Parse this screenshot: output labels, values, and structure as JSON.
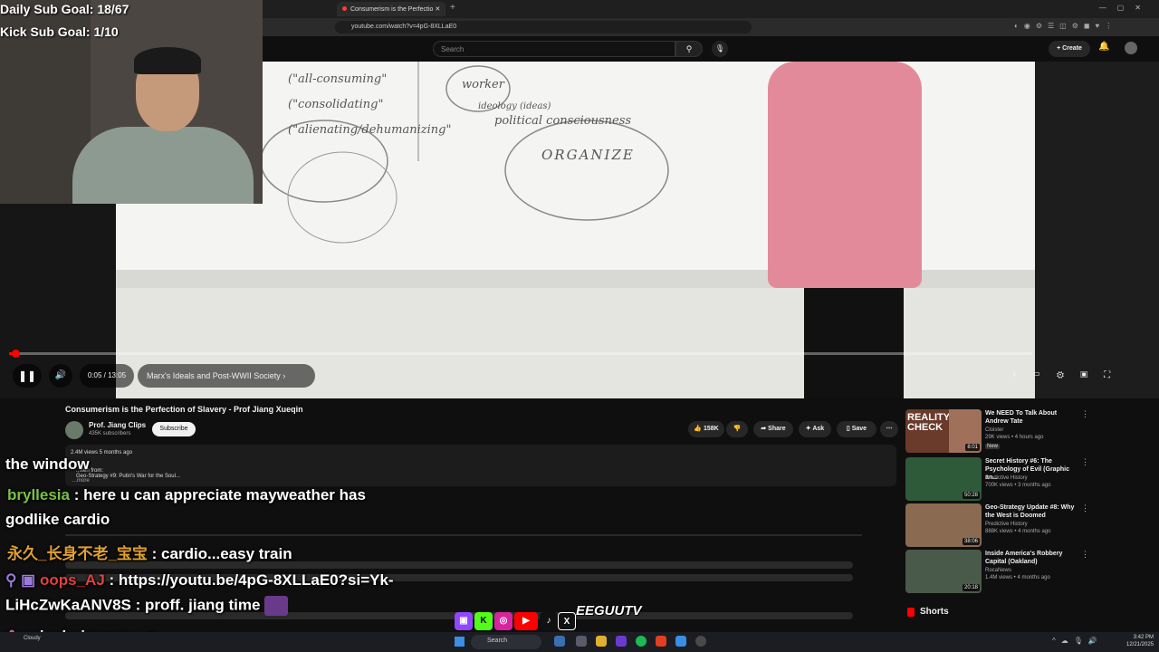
{
  "overlay": {
    "daily_goal": "Daily Sub Goal: 18/67",
    "kick_goal": "Kick Sub Goal: 1/10"
  },
  "browser": {
    "tab_title": "Consumerism is the Perfectio",
    "url": "youtube.com/watch?v=4pG-8XLLaE0"
  },
  "youtube": {
    "search_placeholder": "Search",
    "create_label": "Create",
    "player": {
      "time": "0:05 / 13:05",
      "chapter": "Marx's Ideals and Post-WWII Society",
      "progress": 0.006
    },
    "video": {
      "title": "Consumerism is the Perfection of Slavery - Prof Jiang Xueqin",
      "channel": "Prof. Jiang Clips",
      "subscribers": "435K subscribers",
      "subscribe_label": "Subscribe",
      "likes": "158K",
      "share_label": "Share",
      "ask_label": "Ask",
      "save_label": "Save",
      "views_age": "2.4M views 5 months ago",
      "taken_from": "...ken from:",
      "linked_video": "Geo-Strategy #9:  Putin's War for the Soul...",
      "more": "...more"
    },
    "whiteboard": {
      "line1": "(\"all-consuming\"",
      "line2": "(\"consolidating\"",
      "line3": "(\"alienating/dehumanizing\"",
      "worker": "worker",
      "ideology": "ideology (ideas)",
      "political": "political consciousness",
      "organize": "ORGANIZE"
    },
    "recommendations": [
      {
        "title": "We NEED To Talk About Andrew Tate",
        "channel": "Cloister",
        "meta": "29K views • 4 hours ago",
        "badge": "New",
        "duration": "8:01",
        "thumb_text": "REALITY CHECK",
        "color": "#6a3a2a"
      },
      {
        "title": "Secret History #6:  The Psychology of Evil (Graphic an...",
        "channel": "Predictive History",
        "meta": "700K views • 3 months ago",
        "duration": "50:28",
        "color": "#2f5a3a"
      },
      {
        "title": "Geo-Strategy Update #8:  Why the West is Doomed",
        "channel": "Predictive History",
        "meta": "888K views • 4 months ago",
        "duration": "38:06",
        "color": "#8a6a50"
      },
      {
        "title": "Inside America's Robbery Capital (Oakland)",
        "channel": "RocaNews",
        "meta": "1.4M views • 4 months ago",
        "duration": "20:18",
        "color": "#4a5a4a"
      }
    ],
    "shorts_label": "Shorts"
  },
  "chat": [
    {
      "user": "",
      "message": "the window"
    },
    {
      "user": "bryllesia",
      "message": ": here u can appreciate mayweather has"
    },
    {
      "user": "",
      "message": "godlike cardio"
    },
    {
      "user": "永久_长身不老_宝宝",
      "message": ": cardio...easy train"
    },
    {
      "user": "oops_AJ",
      "message": ": https://youtu.be/4pG-8XLLaE0?si=Yk-"
    },
    {
      "user": "",
      "message": "LiHcZwKaANV8S : proff. jiang time"
    },
    {
      "user": "asianboigangz",
      "message": ":"
    }
  ],
  "branding": {
    "logo_text": "EEGUUTV"
  },
  "taskbar": {
    "weather": "Cloudy",
    "search_placeholder": "Search",
    "time": "3:42 PM",
    "date": "12/21/2025"
  }
}
